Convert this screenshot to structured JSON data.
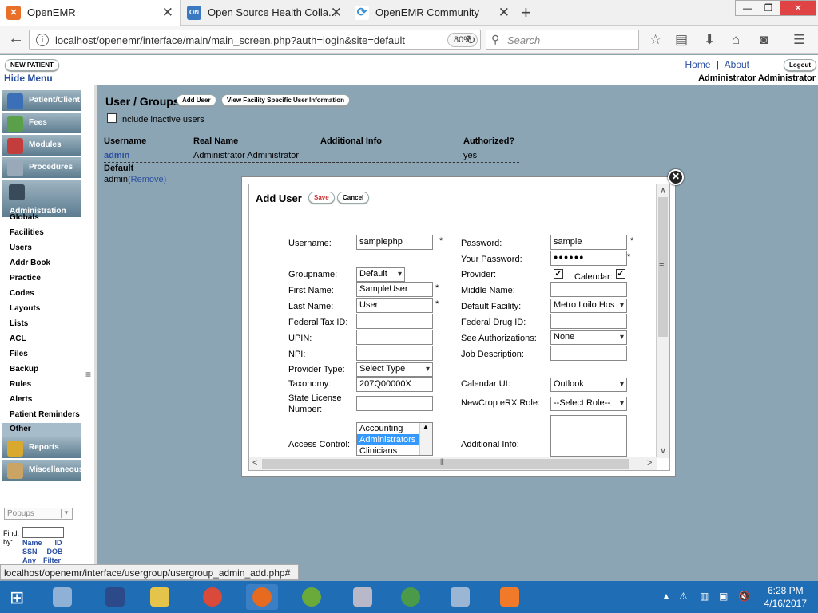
{
  "browser": {
    "tabs": [
      {
        "title": "OpenEMR",
        "fav": "✕",
        "fav_color": "#e8702a"
      },
      {
        "title": "Open Source Health Colla...",
        "fav": "ON",
        "fav_color": "#3a78c2"
      },
      {
        "title": "OpenEMR Community",
        "fav": "⟳",
        "fav_color": "#3b8fd6"
      }
    ],
    "new_tab": "+",
    "window_controls": {
      "minimize": "—",
      "restore": "❐",
      "close": "✕"
    },
    "url": "localhost/openemr/interface/main/main_screen.php?auth=login&site=default",
    "zoom": "80%",
    "search_placeholder": "Search"
  },
  "emr": {
    "new_patient": "NEW PATIENT",
    "hide_menu": "Hide Menu",
    "home": "Home",
    "about": "About",
    "sep": "|",
    "logout": "Logout",
    "user": "Administrator Administrator"
  },
  "menu": {
    "buttons": [
      "Patient/Client",
      "Fees",
      "Modules",
      "Procedures",
      "Administration"
    ],
    "admin_items": [
      "Globals",
      "Facilities",
      "Users",
      "Addr Book",
      "Practice",
      "Codes",
      "Layouts",
      "Lists",
      "ACL",
      "Files",
      "Backup",
      "Rules",
      "Alerts",
      "Patient Reminders"
    ],
    "other": "Other",
    "bottom_buttons": [
      "Reports",
      "Miscellaneous"
    ],
    "popups": "Popups",
    "find_label": "Find:",
    "by_label": "by:",
    "find_links": [
      "Name",
      "ID",
      "SSN",
      "DOB",
      "Any",
      "Filter"
    ]
  },
  "users_page": {
    "title": "User / Groups",
    "add_user": "Add User",
    "view_facility": "View Facility Specific User Information",
    "include_inactive": "Include inactive users",
    "columns": [
      "Username",
      "Real Name",
      "Additional Info",
      "Authorized?"
    ],
    "row": {
      "username": "admin",
      "realname": "Administrator Administrator",
      "info": "",
      "authorized": "yes"
    },
    "group_title": "Default",
    "group_member": "admin",
    "remove": "(Remove)"
  },
  "modal": {
    "title": "Add User",
    "save": "Save",
    "cancel": "Cancel",
    "star": "*",
    "labels": {
      "username": "Username:",
      "password": "Password:",
      "your_password": "Your Password:",
      "groupname": "Groupname:",
      "provider": "Provider:",
      "calendar": "Calendar:",
      "first_name": "First Name:",
      "middle_name": "Middle Name:",
      "last_name": "Last Name:",
      "default_facility": "Default Facility:",
      "federal_tax": "Federal Tax ID:",
      "federal_drug": "Federal Drug ID:",
      "upin": "UPIN:",
      "see_auth": "See Authorizations:",
      "npi": "NPI:",
      "job_desc": "Job Description:",
      "provider_type": "Provider Type:",
      "taxonomy": "Taxonomy:",
      "calendar_ui": "Calendar UI:",
      "state_license_1": "State License",
      "state_license_2": "Number:",
      "newcrop": "NewCrop eRX Role:",
      "access_control": "Access Control:",
      "additional_info": "Additional Info:"
    },
    "values": {
      "username": "samplephp",
      "password": "sample",
      "your_password": "●●●●●●",
      "groupname": "Default",
      "first_name": "SampleUser",
      "middle_name": "",
      "last_name": "User",
      "default_facility": "Metro Iloilo Hos",
      "federal_tax": "",
      "federal_drug": "",
      "upin": "",
      "see_auth": "None",
      "npi": "",
      "job_desc": "",
      "provider_type": "Select Type",
      "taxonomy": "207Q00000X",
      "calendar_ui": "Outlook",
      "state_license": "",
      "newcrop": "--Select Role--"
    },
    "access_options": [
      "Accounting",
      "Administrators",
      "Clinicians"
    ],
    "close": "✕"
  },
  "status_url": "localhost/openemr/interface/usergroup/usergroup_admin_add.php#",
  "clock": {
    "time": "6:28 PM",
    "date": "4/16/2017"
  },
  "colors": {
    "menu_gradient_top": "#9fb5c2",
    "menu_gradient_bottom": "#5c7c8f",
    "page_bg": "#8ca5b5",
    "taskbar": "#1f6db5",
    "link": "#2a4fa0"
  }
}
